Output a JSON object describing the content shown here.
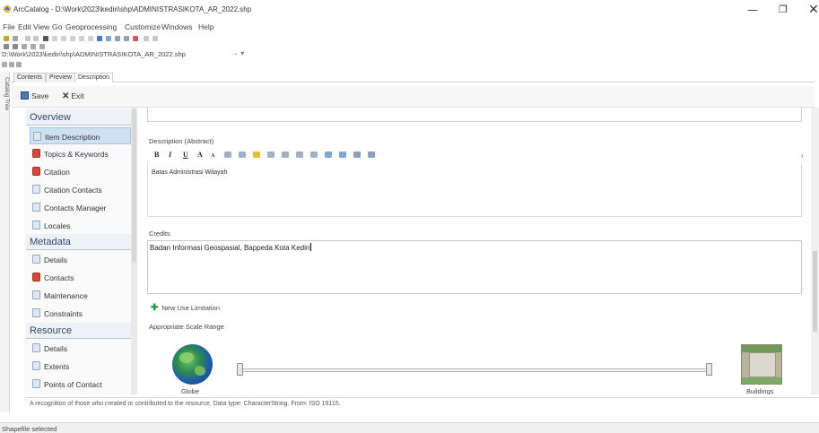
{
  "window": {
    "title": "ArcCatalog - D:\\Work\\2023\\kediri\\shp\\ADMINISTRASIKOTA_AR_2022.shp",
    "minimize_glyph": "—",
    "maximize_glyph": "❐",
    "close_glyph": "✕"
  },
  "menu": [
    "File",
    "Edit",
    "View",
    "Go",
    "Geoprocessing",
    "Customize",
    "Windows",
    "Help"
  ],
  "location": {
    "path": "D:\\Work\\2023\\kediri\\shp\\ADMINISTRASIKOTA_AR_2022.shp",
    "go_glyph": "→ ▾"
  },
  "side_strip": {
    "label": "Catalog Tree"
  },
  "tabs": [
    "Contents",
    "Preview",
    "Description"
  ],
  "actions": {
    "save": "Save",
    "exit": "Exit"
  },
  "nav": {
    "overview_header": "Overview",
    "overview_items": [
      "Item Description",
      "Topics & Keywords",
      "Citation",
      "Citation Contacts",
      "Contacts Manager",
      "Locales"
    ],
    "metadata_header": "Metadata",
    "metadata_items": [
      "Details",
      "Contacts",
      "Maintenance",
      "Constraints"
    ],
    "resource_header": "Resource",
    "resource_items": [
      "Details",
      "Extents",
      "Points of Contact"
    ]
  },
  "description": {
    "abstract_label": "Description (Abstract)",
    "abstract_text": "Batas Administrasi Wilayah",
    "credits_label": "Credits",
    "credits_text": "Badan Informasi Geospasial, Bappeda Kota Kediri",
    "new_use_limitation": "New Use Limitation",
    "scale_range_label": "Appropriate Scale Range",
    "globe_label": "Globe",
    "buildings_label": "Buildings",
    "scale_min_fraction": 0.0,
    "scale_max_fraction": 1.0
  },
  "richtext_toolbar": {
    "bold": "B",
    "italic": "I",
    "underline": "U",
    "superscript": "A",
    "subscript": "A"
  },
  "field_help": "A recognition of those who created or contributed to the resource. Data type: CharacterString. From: ISO 19115.",
  "status": "Shapefile selected",
  "colors": {
    "section_header_text": "#2e4b6a",
    "selected_item": "#cfe0f3",
    "add_icon": "#2e9b3e",
    "citation_icon": "#d44a3a"
  }
}
